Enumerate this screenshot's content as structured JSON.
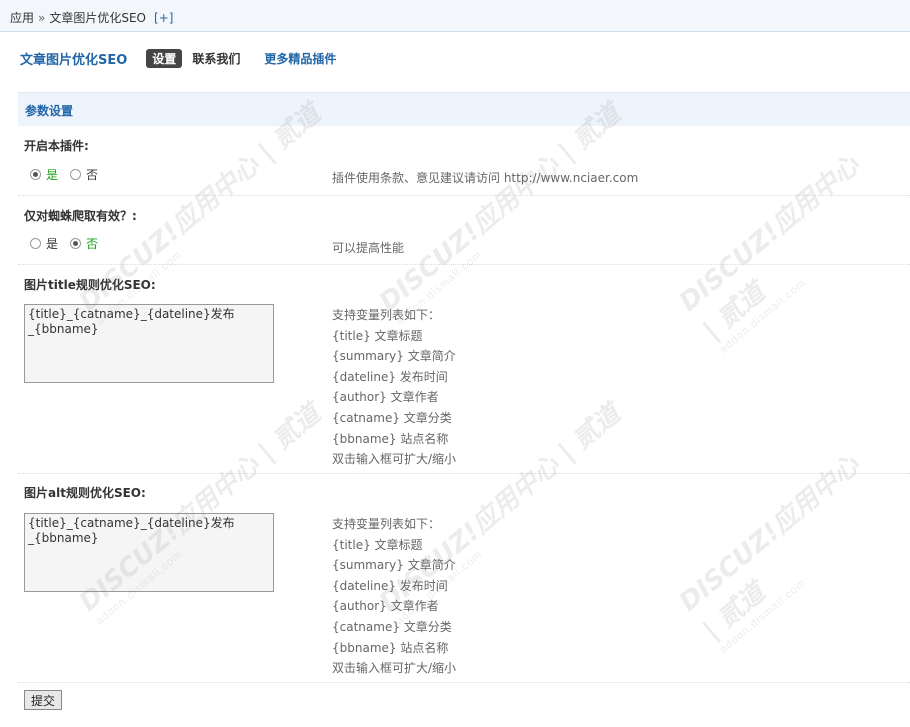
{
  "breadcrumb": {
    "root": "应用",
    "separator": "»",
    "current": "文章图片优化SEO",
    "add": "[+]"
  },
  "header": {
    "title": "文章图片优化SEO",
    "tabs": [
      "设置",
      "联系我们",
      "更多精品插件"
    ]
  },
  "section": {
    "title": "参数设置"
  },
  "settings": {
    "enable": {
      "label": "开启本插件:",
      "options": [
        "是",
        "否"
      ],
      "selected": "是",
      "hint": "插件使用条款、意见建议请访问 http://www.nciaer.com"
    },
    "spider_only": {
      "label": "仅对蜘蛛爬取有效？:",
      "options": [
        "是",
        "否"
      ],
      "selected": "否",
      "hint": "可以提高性能"
    },
    "title_rule": {
      "label": "图片title规则优化SEO:",
      "value": "{title}_{catname}_{dateline}发布_{bbname}",
      "help": [
        "支持变量列表如下：",
        "{title} 文章标题",
        "{summary} 文章简介",
        "{dateline} 发布时间",
        "{author} 文章作者",
        "{catname} 文章分类",
        "{bbname} 站点名称",
        "双击输入框可扩大/缩小"
      ]
    },
    "alt_rule": {
      "label": "图片alt规则优化SEO:",
      "value": "{title}_{catname}_{dateline}发布_{bbname}",
      "help": [
        "支持变量列表如下：",
        "{title} 文章标题",
        "{summary} 文章简介",
        "{dateline} 发布时间",
        "{author} 文章作者",
        "{catname} 文章分类",
        "{bbname} 站点名称",
        "双击输入框可扩大/缩小"
      ]
    }
  },
  "submit_label": "提交",
  "watermark": {
    "brand": "DISCUZ!应用中心 | 贰道",
    "domain": "addon.dismall.com"
  },
  "colors": {
    "link": "#2366a8",
    "selected_option": "#1aa01a",
    "section_bg": "#eef4fb"
  }
}
